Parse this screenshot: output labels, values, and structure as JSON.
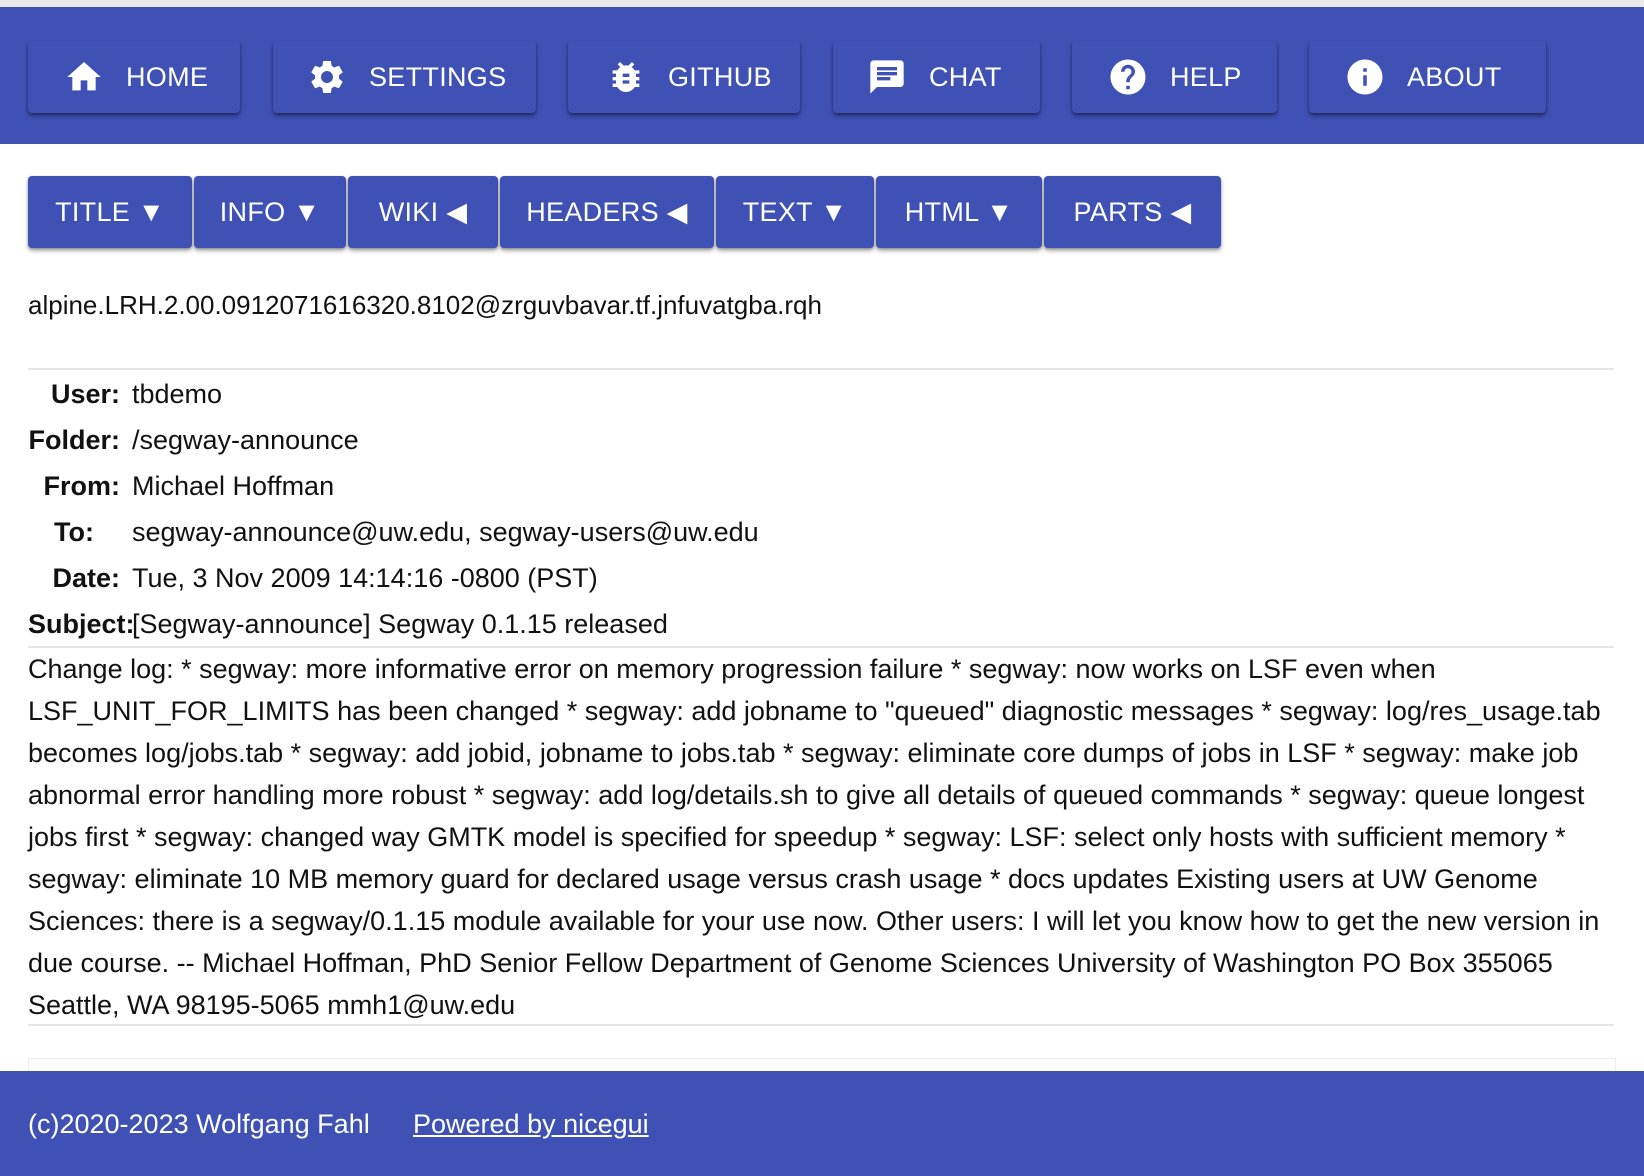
{
  "nav": {
    "home": "HOME",
    "settings": "SETTINGS",
    "github": "GITHUB",
    "chat": "CHAT",
    "help": "HELP",
    "about": "ABOUT"
  },
  "sections": {
    "title": "TITLE ▼",
    "info": "INFO ▼",
    "wiki": "WIKI ◀",
    "headers": "HEADERS ◀",
    "text": "TEXT ▼",
    "html": "HTML ▼",
    "parts": "PARTS ◀"
  },
  "message": {
    "id": "alpine.LRH.2.00.0912071616320.8102@zrguvbavar.tf.jnfuvatgba.rqh",
    "headers": {
      "user_label": "User:",
      "user": "tbdemo",
      "folder_label": "Folder:",
      "folder": "/segway-announce",
      "from_label": "From:",
      "from": "Michael Hoffman",
      "to_label": "To:",
      "to": "segway-announce@uw.edu, segway-users@uw.edu",
      "date_label": "Date:",
      "date": "Tue, 3 Nov 2009 14:14:16 -0800 (PST)",
      "subject_label": "Subject:",
      "subject": "[Segway-announce] Segway 0.1.15 released"
    },
    "body": "Change log: * segway: more informative error on memory progression failure * segway: now works on LSF even when LSF_UNIT_FOR_LIMITS has been changed * segway: add jobname to \"queued\" diagnostic messages * segway: log/res_usage.tab becomes log/jobs.tab * segway: add jobid, jobname to jobs.tab * segway: eliminate core dumps of jobs in LSF * segway: make job abnormal error handling more robust * segway: add log/details.sh to give all details of queued commands * segway: queue longest jobs first * segway: changed way GMTK model is specified for speedup * segway: LSF: select only hosts with sufficient memory * segway: eliminate 10 MB memory guard for declared usage versus crash usage * docs updates Existing users at UW Genome Sciences: there is a segway/0.1.15 module available for your use now. Other users: I will let you know how to get the new version in due course. -- Michael Hoffman, PhD Senior Fellow Department of Genome Sciences University of Washington PO Box 355065 Seattle, WA 98195-5065 mmh1@uw.edu"
  },
  "footer": {
    "copyright": "(c)2020-2023 Wolfgang Fahl",
    "powered": "Powered by nicegui"
  },
  "colors": {
    "primary": "#3f51b5",
    "text": "#111111",
    "divider": "#e6e6e6"
  },
  "icons": {
    "home": "home-icon",
    "settings": "gear-icon",
    "github": "bug-icon",
    "chat": "chat-icon",
    "help": "help-icon",
    "about": "info-icon"
  }
}
